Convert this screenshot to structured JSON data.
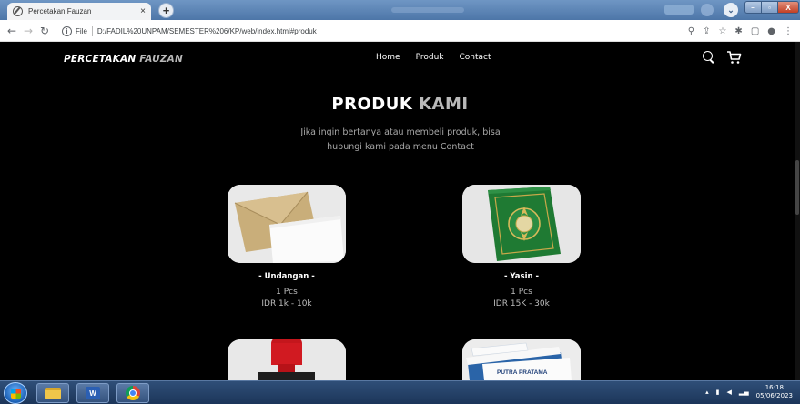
{
  "browser": {
    "tab_title": "Percetakan Fauzan",
    "tab_close": "×",
    "new_tab": "+",
    "url_scheme": "File",
    "url": "D:/FADIL%20UNPAM/SEMESTER%206/KP/web/index.html#produk",
    "window_controls": {
      "minimize": "–",
      "maximize": "▫",
      "close": "X"
    }
  },
  "navbar": {
    "brand_main": "PERCETAKAN",
    "brand_accent": "FAUZAN",
    "links": [
      "Home",
      "Produk",
      "Contact"
    ]
  },
  "section": {
    "title_main": "PRODUK",
    "title_accent": "KAMI",
    "subtitle_line1": "Jika ingin bertanya atau membeli produk, bisa",
    "subtitle_line2": "hubungi kami pada menu Contact"
  },
  "products": [
    {
      "name": "- Undangan -",
      "qty": "1 Pcs",
      "price": "IDR 1k - 10k",
      "image": "envelope-image"
    },
    {
      "name": "- Yasin -",
      "qty": "1 Pcs",
      "price": "IDR 15K - 30k",
      "image": "yasin-book-image"
    },
    {
      "image": "stamp-image"
    },
    {
      "image": "business-card-image",
      "card_text": "PUTRA PRATAMA"
    }
  ],
  "taskbar": {
    "time": "16:18",
    "date": "05/06/2023",
    "word_label": "W"
  },
  "colors": {
    "page_bg": "#000000",
    "accent_text": "#b9b9b9",
    "taskbar": "#1c3559"
  }
}
